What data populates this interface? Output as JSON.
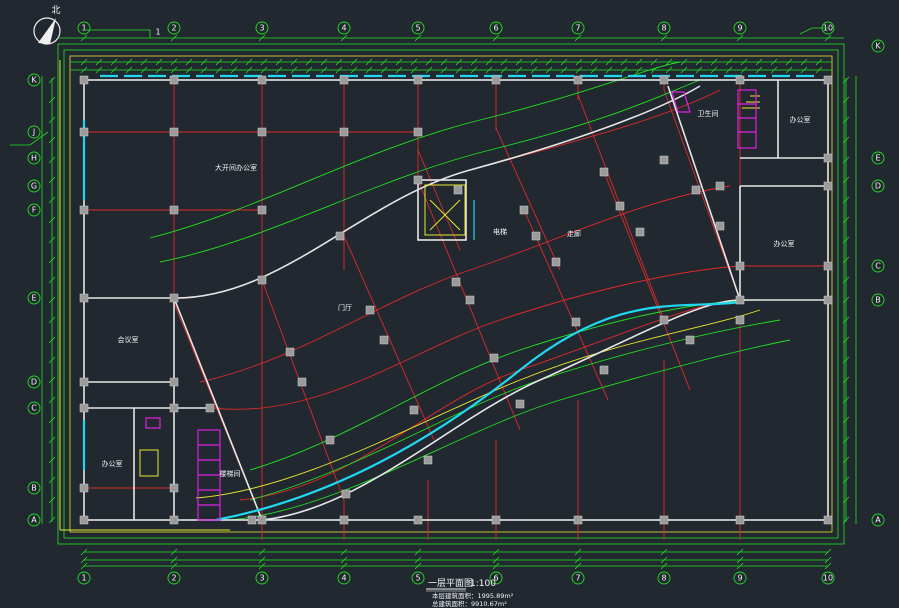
{
  "drawing": {
    "title": "一层平面图",
    "scale": "1:100",
    "area_lines": [
      "本层建筑面积：1995.89m²",
      "总建筑面积：9910.67m²"
    ],
    "north_label": "北",
    "bubble_top": "1"
  },
  "column_axes": [
    "1",
    "2",
    "3",
    "4",
    "5",
    "6",
    "7",
    "8",
    "9",
    "10"
  ],
  "row_axes": [
    "A",
    "B",
    "C",
    "D",
    "E",
    "F",
    "G",
    "H",
    "J",
    "K"
  ],
  "rooms": {
    "large_office": "大开间办公室",
    "meeting_room": "会议室",
    "hall": "门厅",
    "corridor": "走廊",
    "toilet": "卫生间",
    "office_left": "办公室",
    "lift": "电梯",
    "office_right_top": "办公室",
    "office_right_bottom": "办公室",
    "stair": "楼梯间"
  },
  "colors": {
    "background": "#212830",
    "axis_green": "#22e022",
    "grid_red": "#e02a2a",
    "wall_white": "#e6e6e6",
    "glass_cyan": "#21d7f0",
    "yellow": "#e8e830",
    "magenta": "#e020e0"
  }
}
